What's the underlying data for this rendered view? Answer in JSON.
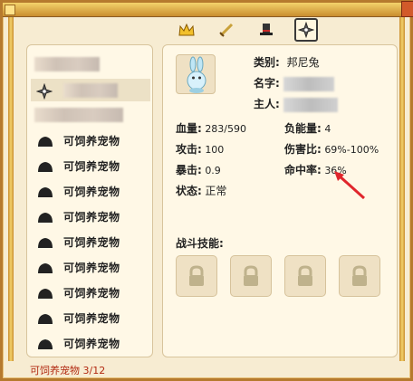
{
  "window": {
    "tabs": [
      {
        "icon": "crown-icon",
        "active": false
      },
      {
        "icon": "sword-icon",
        "active": false
      },
      {
        "icon": "top-hat-icon",
        "active": false
      },
      {
        "icon": "shuriken-icon",
        "active": true
      }
    ]
  },
  "pet_list": {
    "items": [
      {
        "label": "",
        "icon": "blurred",
        "selected": false
      },
      {
        "label": "",
        "icon": "shuriken-icon",
        "selected": true
      },
      {
        "label": "",
        "icon": "blurred",
        "selected": false
      },
      {
        "label": "可饲养宠物",
        "icon": "egg-silhouette-icon",
        "selected": false
      },
      {
        "label": "可饲养宠物",
        "icon": "egg-silhouette-icon",
        "selected": false
      },
      {
        "label": "可饲养宠物",
        "icon": "egg-silhouette-icon",
        "selected": false
      },
      {
        "label": "可饲养宠物",
        "icon": "egg-silhouette-icon",
        "selected": false
      },
      {
        "label": "可饲养宠物",
        "icon": "egg-silhouette-icon",
        "selected": false
      },
      {
        "label": "可饲养宠物",
        "icon": "egg-silhouette-icon",
        "selected": false
      },
      {
        "label": "可饲养宠物",
        "icon": "egg-silhouette-icon",
        "selected": false
      },
      {
        "label": "可饲养宠物",
        "icon": "egg-silhouette-icon",
        "selected": false
      },
      {
        "label": "可饲养宠物",
        "icon": "egg-silhouette-icon",
        "selected": false
      }
    ],
    "footer": "可饲养宠物 3/12"
  },
  "pet_detail": {
    "category_label": "类别:",
    "category_value": "邦尼兔",
    "name_label": "名字:",
    "owner_label": "主人:",
    "stats": {
      "hp_label": "血量:",
      "hp_value": "283/590",
      "load_label": "负能量:",
      "load_value": "4",
      "attack_label": "攻击:",
      "attack_value": "100",
      "damage_label": "伤害比:",
      "damage_value": "69%-100%",
      "crit_label": "暴击:",
      "crit_value": "0.9",
      "hit_label": "命中率:",
      "hit_value": "36%",
      "status_label": "状态:",
      "status_value": "正常"
    },
    "skills_label": "战斗技能:",
    "skill_slots": [
      "locked",
      "locked",
      "locked",
      "locked"
    ]
  },
  "colors": {
    "accent_red": "#b22a12",
    "annotation_arrow": "#e0262c",
    "frame_gold": "#c98d2f"
  }
}
